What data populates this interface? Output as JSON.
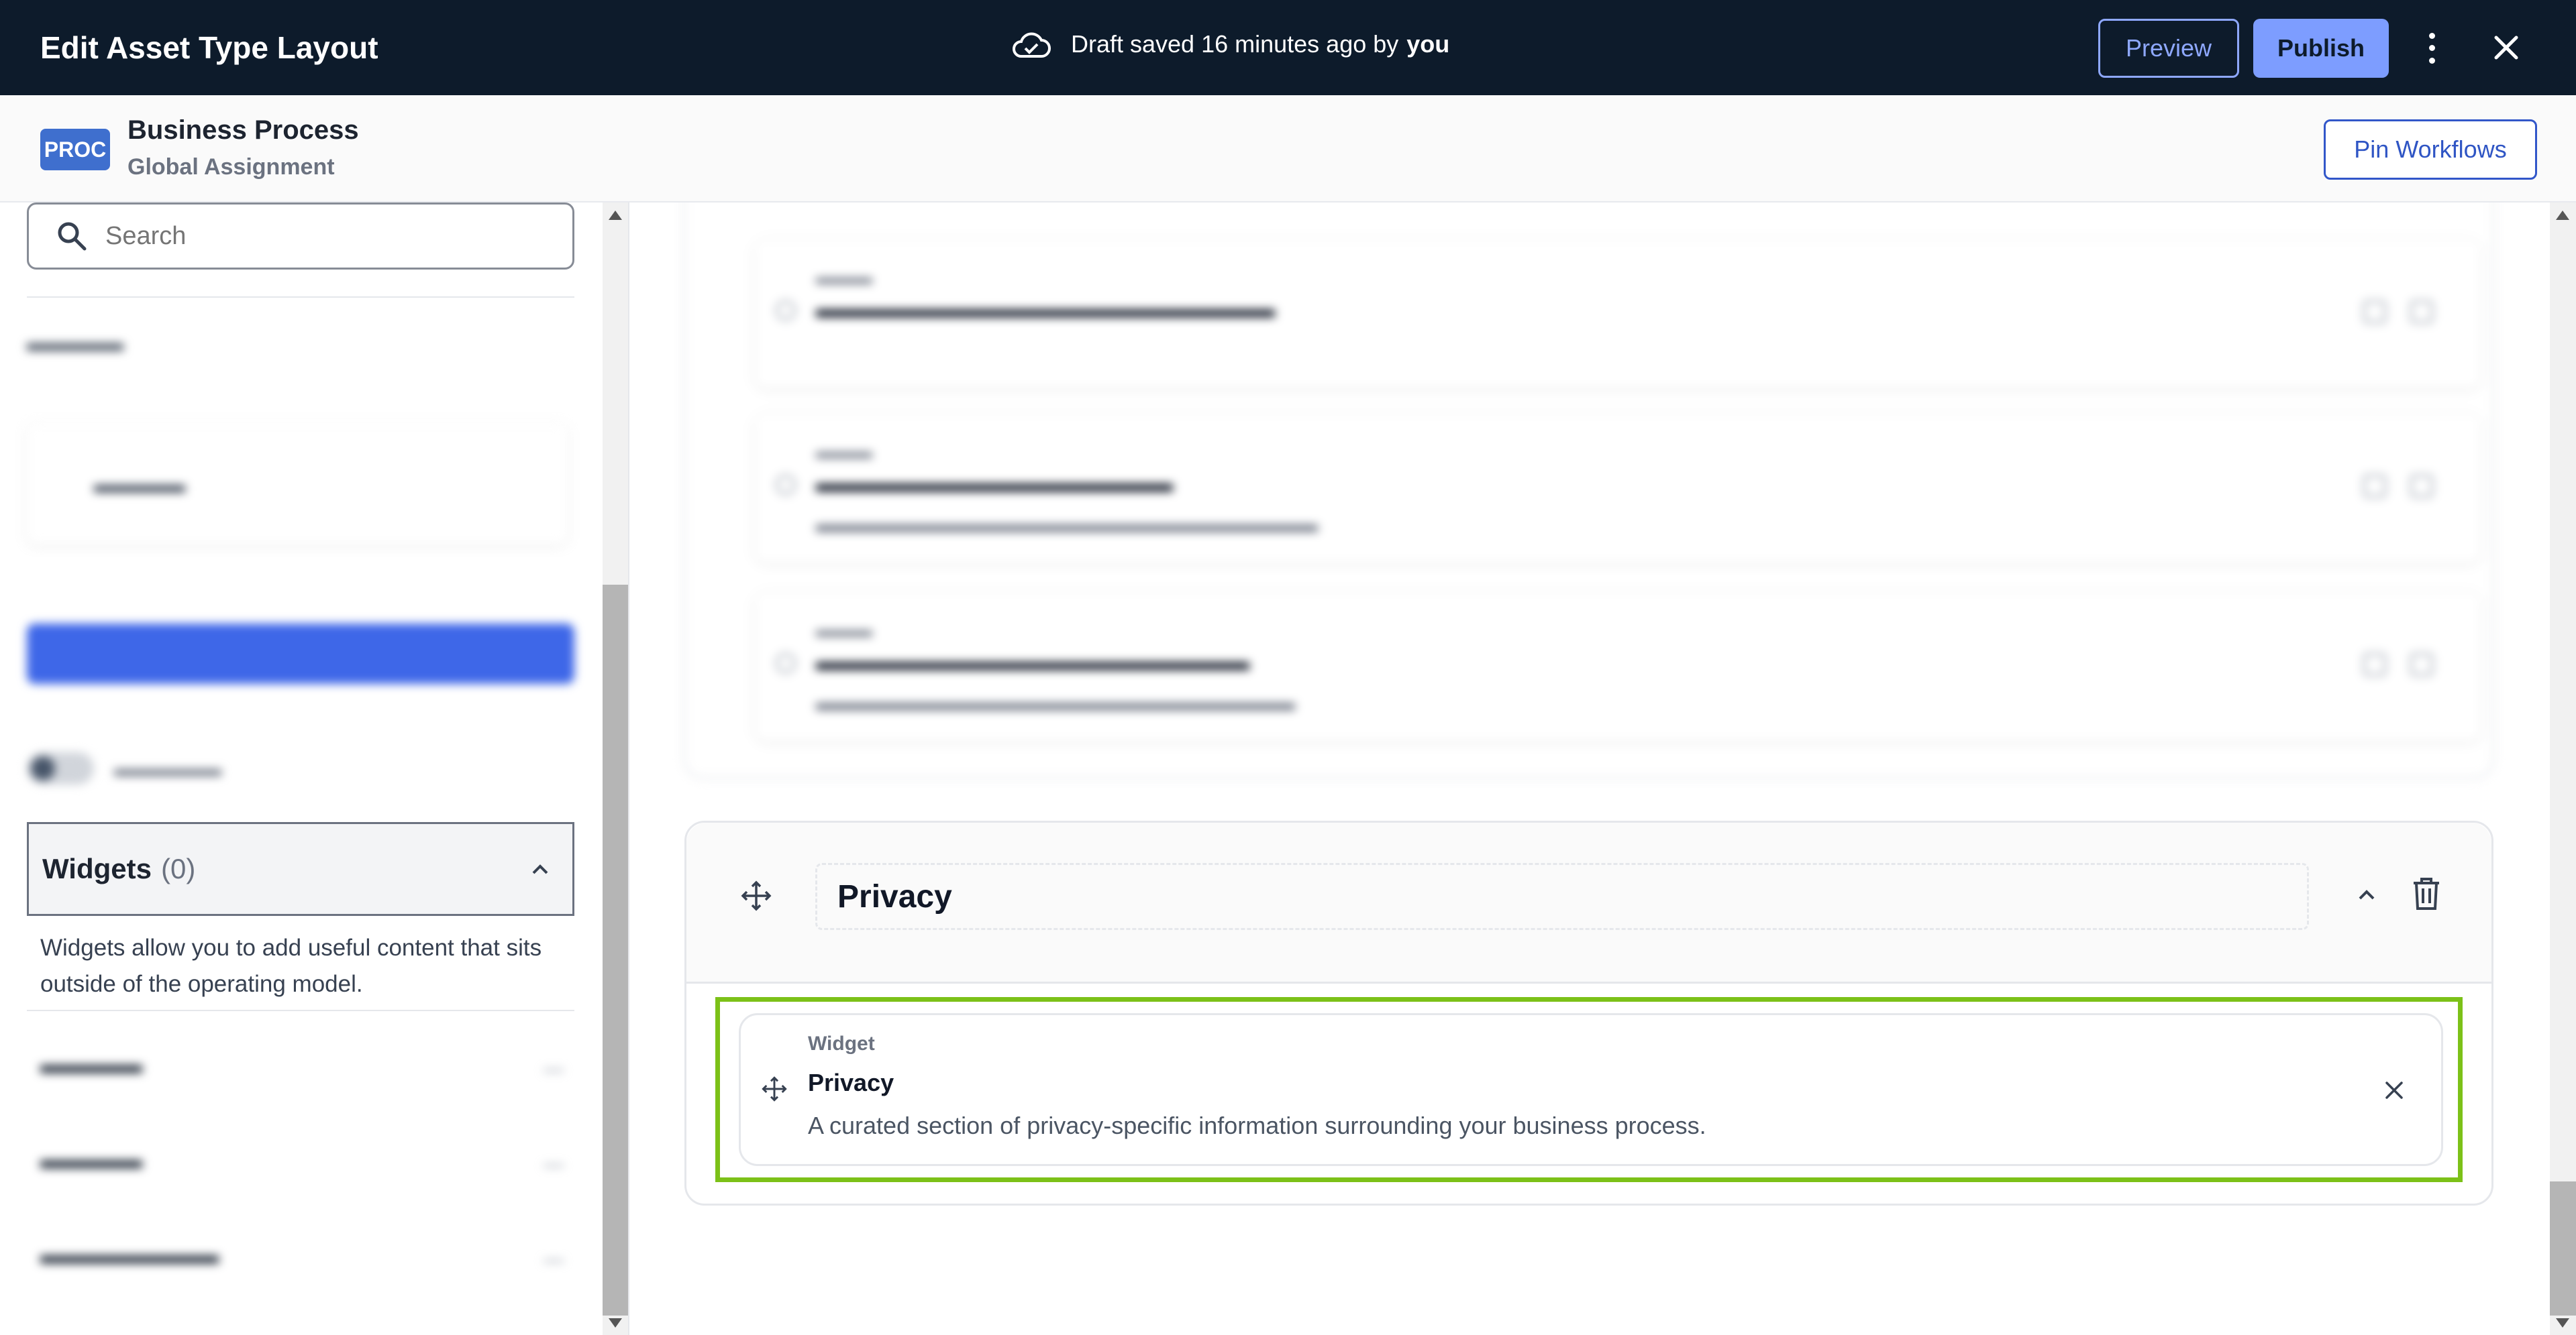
{
  "topbar": {
    "title": "Edit Asset Type Layout",
    "draft_text": "Draft saved 16 minutes ago by",
    "draft_user": "you",
    "preview_label": "Preview",
    "publish_label": "Publish"
  },
  "asset": {
    "badge": "PROC",
    "name": "Business Process",
    "subtitle": "Global Assignment",
    "pin_label": "Pin Workflows"
  },
  "sidebar": {
    "search_placeholder": "Search",
    "widgets_title": "Widgets",
    "widgets_count": "(0)",
    "widgets_description": "Widgets allow you to add useful content that sits outside of the operating model."
  },
  "section": {
    "title": "Privacy"
  },
  "widget": {
    "label": "Widget",
    "name": "Privacy",
    "description": "A curated section of privacy-specific information surrounding your business process."
  },
  "colors": {
    "topbar_bg": "#0d1b2b",
    "accent": "#3e67e8",
    "highlight": "#7cc118",
    "badge": "#3f6fce"
  }
}
